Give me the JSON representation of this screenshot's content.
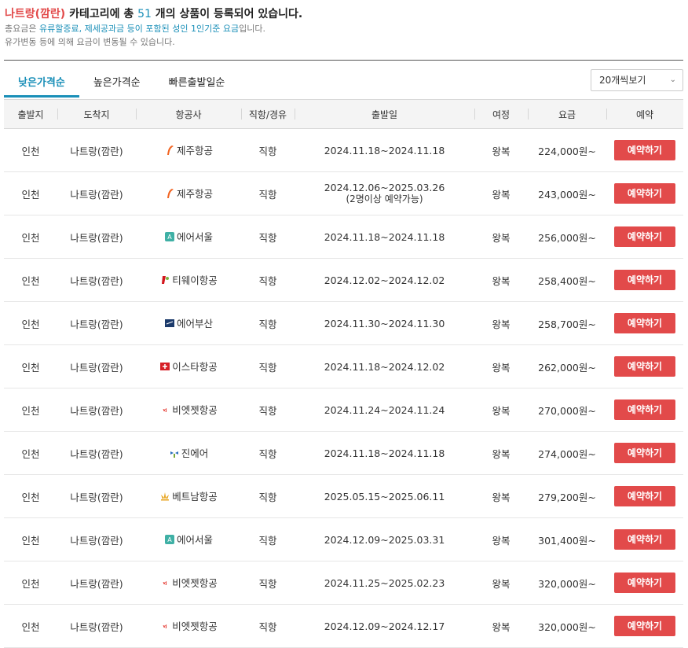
{
  "summary": {
    "category": "나트랑(깜란)",
    "text_before_count": " 카테고리에 총 ",
    "count": "51",
    "text_after_count": " 개의 상품이 등록되어 있습니다.",
    "note1_prefix": "총요금은 ",
    "note1_highlight": "유류할증료, 제세공과금 등이 포함된 성인 1인기준 요금",
    "note1_suffix": "입니다.",
    "note2": "유가변동 등에 의해 요금이 변동될 수 있습니다."
  },
  "tabs": [
    {
      "label": "낮은가격순",
      "active": true
    },
    {
      "label": "높은가격순",
      "active": false
    },
    {
      "label": "빠른출발일순",
      "active": false
    }
  ],
  "per_page": {
    "selected": "20개씩보기"
  },
  "table": {
    "headers": [
      "출발지",
      "도착지",
      "항공사",
      "직항/경유",
      "출발일",
      "여정",
      "요금",
      "예약"
    ],
    "reserve_label": "예약하기",
    "rows": [
      {
        "from": "인천",
        "to": "나트랑(깜란)",
        "airline": "제주항공",
        "logo": "jeju-air",
        "route": "직항",
        "dates": "2024.11.18~2024.11.18",
        "note": "",
        "trip": "왕복",
        "price": "224,000원~"
      },
      {
        "from": "인천",
        "to": "나트랑(깜란)",
        "airline": "제주항공",
        "logo": "jeju-air",
        "route": "직항",
        "dates": "2024.12.06~2025.03.26",
        "note": "(2명이상 예약가능)",
        "trip": "왕복",
        "price": "243,000원~"
      },
      {
        "from": "인천",
        "to": "나트랑(깜란)",
        "airline": "에어서울",
        "logo": "air-seoul",
        "route": "직항",
        "dates": "2024.11.18~2024.11.18",
        "note": "",
        "trip": "왕복",
        "price": "256,000원~"
      },
      {
        "from": "인천",
        "to": "나트랑(깜란)",
        "airline": "티웨이항공",
        "logo": "tway",
        "route": "직항",
        "dates": "2024.12.02~2024.12.02",
        "note": "",
        "trip": "왕복",
        "price": "258,400원~"
      },
      {
        "from": "인천",
        "to": "나트랑(깜란)",
        "airline": "에어부산",
        "logo": "air-busan",
        "route": "직항",
        "dates": "2024.11.30~2024.11.30",
        "note": "",
        "trip": "왕복",
        "price": "258,700원~"
      },
      {
        "from": "인천",
        "to": "나트랑(깜란)",
        "airline": "이스타항공",
        "logo": "eastar",
        "route": "직항",
        "dates": "2024.11.18~2024.12.02",
        "note": "",
        "trip": "왕복",
        "price": "262,000원~"
      },
      {
        "from": "인천",
        "to": "나트랑(깜란)",
        "airline": "비엣젯항공",
        "logo": "vietjet",
        "route": "직항",
        "dates": "2024.11.24~2024.11.24",
        "note": "",
        "trip": "왕복",
        "price": "270,000원~"
      },
      {
        "from": "인천",
        "to": "나트랑(깜란)",
        "airline": "진에어",
        "logo": "jin-air",
        "route": "직항",
        "dates": "2024.11.18~2024.11.18",
        "note": "",
        "trip": "왕복",
        "price": "274,000원~"
      },
      {
        "from": "인천",
        "to": "나트랑(깜란)",
        "airline": "베트남항공",
        "logo": "vietnam-airlines",
        "route": "직항",
        "dates": "2025.05.15~2025.06.11",
        "note": "",
        "trip": "왕복",
        "price": "279,200원~"
      },
      {
        "from": "인천",
        "to": "나트랑(깜란)",
        "airline": "에어서울",
        "logo": "air-seoul",
        "route": "직항",
        "dates": "2024.12.09~2025.03.31",
        "note": "",
        "trip": "왕복",
        "price": "301,400원~"
      },
      {
        "from": "인천",
        "to": "나트랑(깜란)",
        "airline": "비엣젯항공",
        "logo": "vietjet",
        "route": "직항",
        "dates": "2024.11.25~2025.02.23",
        "note": "",
        "trip": "왕복",
        "price": "320,000원~"
      },
      {
        "from": "인천",
        "to": "나트랑(깜란)",
        "airline": "비엣젯항공",
        "logo": "vietjet",
        "route": "직항",
        "dates": "2024.12.09~2024.12.17",
        "note": "",
        "trip": "왕복",
        "price": "320,000원~"
      }
    ]
  }
}
